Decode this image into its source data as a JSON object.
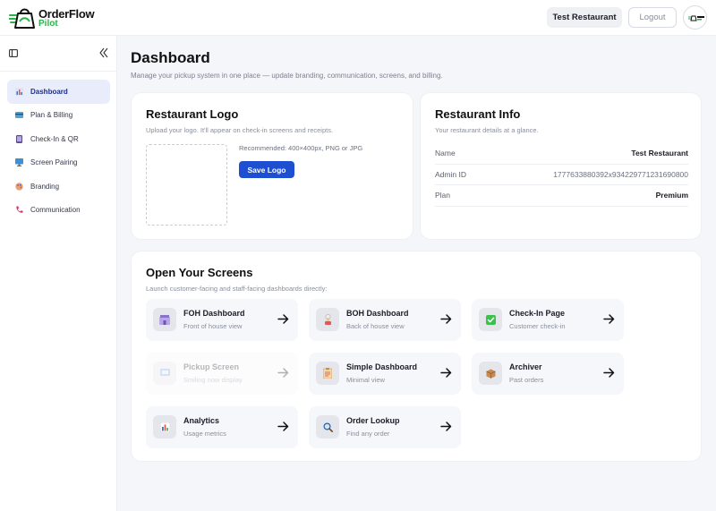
{
  "brand": {
    "name": "OrderFlow",
    "sub": "Pilot"
  },
  "header": {
    "restaurant_button": "Test Restaurant",
    "logout_button": "Logout"
  },
  "sidebar": {
    "items": [
      {
        "label": "Dashboard",
        "icon": "bar-chart-icon",
        "active": true
      },
      {
        "label": "Plan & Billing",
        "icon": "credit-card-icon"
      },
      {
        "label": "Check-In & QR",
        "icon": "phone-icon"
      },
      {
        "label": "Screen Pairing",
        "icon": "monitor-icon"
      },
      {
        "label": "Branding",
        "icon": "palette-icon"
      },
      {
        "label": "Communication",
        "icon": "telephone-icon"
      }
    ]
  },
  "page": {
    "title": "Dashboard",
    "subtitle": "Manage your pickup system in one place — update branding, communication, screens, and billing."
  },
  "logo_card": {
    "title": "Restaurant Logo",
    "subtitle": "Upload your logo. It'll appear on check-in screens and receipts.",
    "recommendation": "Recommended: 400×400px, PNG or JPG",
    "save_label": "Save Logo"
  },
  "info_card": {
    "title": "Restaurant Info",
    "subtitle": "Your restaurant details at a glance.",
    "rows": [
      {
        "key": "Name",
        "value": "Test Restaurant"
      },
      {
        "key": "Admin ID",
        "value": "1777633880392x934229771231690800"
      },
      {
        "key": "Plan",
        "value": "Premium"
      }
    ]
  },
  "screens_card": {
    "title": "Open Your Screens",
    "subtitle": "Launch customer-facing and staff-facing dashboards directly:",
    "tiles": [
      {
        "title": "FOH Dashboard",
        "sub": "Front of house view",
        "icon": "foh-icon"
      },
      {
        "title": "BOH Dashboard",
        "sub": "Back of house view",
        "icon": "chef-icon"
      },
      {
        "title": "Check-In Page",
        "sub": "Customer check-in",
        "icon": "checkmark-icon"
      },
      {
        "title": "Pickup Screen",
        "sub": "Smiling now display",
        "icon": "pickup-icon",
        "disabled": true
      },
      {
        "title": "Simple Dashboard",
        "sub": "Minimal view",
        "icon": "clipboard-icon"
      },
      {
        "title": "Archiver",
        "sub": "Past orders",
        "icon": "box-icon"
      },
      {
        "title": "Analytics",
        "sub": "Usage metrics",
        "icon": "chart-icon"
      },
      {
        "title": "Order Lookup",
        "sub": "Find any order",
        "icon": "magnifier-icon"
      }
    ]
  },
  "colors": {
    "accent": "#1e4fd1",
    "brand_green": "#2bb24c",
    "active_nav": "#e9edfb"
  }
}
